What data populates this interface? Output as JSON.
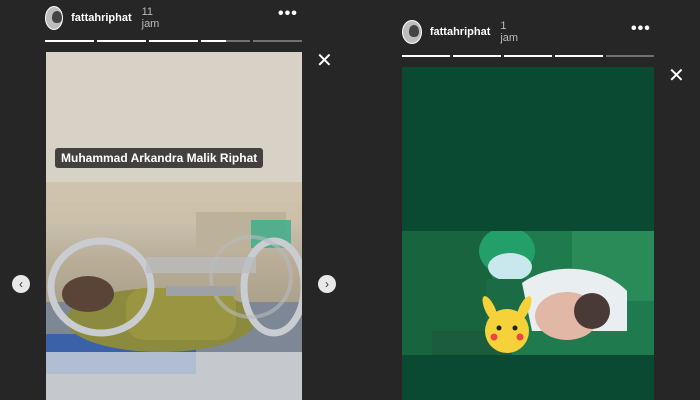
{
  "stories": [
    {
      "username": "fattahriphat",
      "time": "11 jam",
      "more_icon": "more-dots-icon",
      "progress": [
        1,
        1,
        1,
        0.5,
        0
      ],
      "caption": "Muhammad Arkandra Malik Riphat",
      "close_icon": "close-icon",
      "prev_icon": "chevron-left-icon",
      "next_icon": "chevron-right-icon"
    },
    {
      "username": "fattahriphat",
      "time": "1 jam",
      "more_icon": "more-dots-icon",
      "progress": [
        1,
        1,
        1,
        1,
        0
      ],
      "close_icon": "close-icon"
    }
  ],
  "colors": {
    "background": "#262626",
    "story2_background": "#0b4a32",
    "surgical_green": "#1d7a4a"
  }
}
